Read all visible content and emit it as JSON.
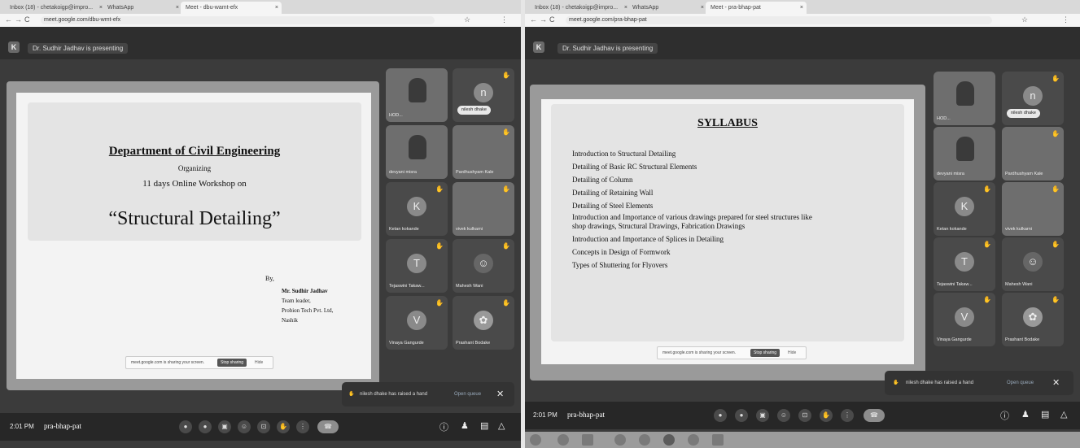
{
  "left": {
    "tabs": [
      "Inbox (18) - chetakoigp@impro...",
      "WhatsApp",
      "Meet - dbu-wamt-efx"
    ],
    "url": "meet.google.com/dbu-wmt-efx",
    "presenting": "Dr. Sudhir Jadhav is presenting",
    "slide": {
      "heading": "Department of Civil Engineering",
      "organizing": "Organizing",
      "workshop": "11 days  Online Workshop on",
      "title": "“Structural Detailing”",
      "by": "By,",
      "speaker": "Mr. Sudhir Jadhav",
      "role": "Team leader,",
      "company": "Probion Tech Pvt. Ltd,",
      "city": "Nashik"
    },
    "share_bar": {
      "text": "meet.google.com is sharing your screen.",
      "stop": "Stop sharing",
      "hide": "Hide"
    },
    "tiles": [
      "HOD...",
      "nilesh dhake",
      "devyani misra",
      "Pardhushyam Kale",
      "Ketan kokande",
      "vivek kulkarni",
      "Tejaswini Takaw...",
      "Mahesh Wani",
      "Vinaya Gangurde",
      "Prashant Bodake"
    ],
    "notification": {
      "text": "nilesh dhake has raised a hand",
      "queue": "Open queue",
      "close": "✕"
    },
    "bottom": {
      "time": "2:01 PM",
      "code": "pra-bhap-pat"
    }
  },
  "right": {
    "tabs": [
      "Inbox (18) - chetakoigp@impro...",
      "WhatsApp",
      "Meet - pra-bhap-pat"
    ],
    "url": "meet.google.com/pra-bhap-pat",
    "presenting": "Dr. Sudhir Jadhav is presenting",
    "slide": {
      "title": "SYLLABUS",
      "items": [
        "Introduction to Structural Detailing",
        "Detailing of Basic RC Structural Elements",
        "Detailing of Column",
        "Detailing of Retaining Wall",
        "Detailing of Steel Elements",
        "Introduction and Importance of various drawings prepared for steel structures like",
        "shop drawings, Structural Drawings, Fabrication Drawings",
        "Introduction and Importance of Splices in Detailing",
        "Concepts in Design of Formwork",
        "Types of Shuttering for Flyovers"
      ]
    },
    "share_bar": {
      "text": "meet.google.com is sharing your screen.",
      "stop": "Stop sharing",
      "hide": "Hide"
    },
    "tiles": [
      "HOD...",
      "nilesh dhake",
      "devyani misra",
      "Pardhushyam Kale",
      "Ketan kokande",
      "vivek kulkarni",
      "Tejaswini Takaw...",
      "Mahesh Wani",
      "Vinaya Gangurde",
      "Prashant Bodake"
    ],
    "notification": {
      "text": "nilesh dhake has raised a hand",
      "queue": "Open queue",
      "close": "✕"
    },
    "bottom": {
      "time": "2:01 PM",
      "code": "pra-bhap-pat"
    }
  },
  "icons": {
    "back": "←",
    "forward": "→",
    "reload": "C",
    "star": "☆",
    "hand": "✋",
    "info": "ⓘ",
    "people": "♟",
    "chat": "▤",
    "activities": "△",
    "more": "⋮",
    "end": "☎",
    "mic": "●",
    "cam": "●",
    "cc": "▣",
    "emoji": "☺",
    "present": "⊡"
  }
}
